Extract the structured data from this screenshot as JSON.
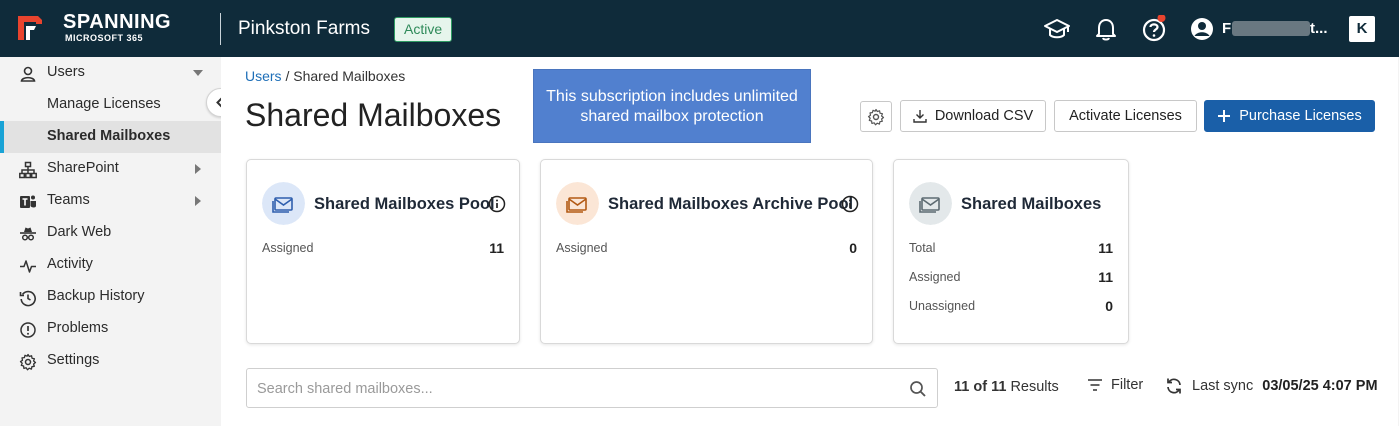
{
  "header": {
    "brand": "SPANNING",
    "brand_sub": "MICROSOFT 365",
    "org_name": "Pinkston Farms",
    "org_status": "Active",
    "user_initial": "F",
    "user_suffix": "t..."
  },
  "sidebar": {
    "items": [
      {
        "label": "Users",
        "icon": "user-icon"
      },
      {
        "label": "Manage Licenses"
      },
      {
        "label": "Shared Mailboxes"
      },
      {
        "label": "SharePoint",
        "icon": "sitemap-icon"
      },
      {
        "label": "Teams",
        "icon": "teams-icon"
      },
      {
        "label": "Dark Web",
        "icon": "spy-icon"
      },
      {
        "label": "Activity",
        "icon": "activity-icon"
      },
      {
        "label": "Backup History",
        "icon": "history-icon"
      },
      {
        "label": "Problems",
        "icon": "alert-circle-icon"
      },
      {
        "label": "Settings",
        "icon": "gear-icon"
      }
    ]
  },
  "main": {
    "breadcrumb_link": "Users",
    "breadcrumb_current": "/ Shared Mailboxes",
    "title": "Shared Mailboxes",
    "tooltip": "This subscription includes unlimited shared mailbox protection",
    "buttons": {
      "download": "Download CSV",
      "activate": "Activate Licenses",
      "purchase": "Purchase Licenses"
    },
    "cards": [
      {
        "title": "Shared Mailboxes Pool",
        "rows": [
          {
            "label": "Assigned",
            "value": "11"
          }
        ]
      },
      {
        "title": "Shared Mailboxes Archive Pool",
        "rows": [
          {
            "label": "Assigned",
            "value": "0"
          }
        ]
      },
      {
        "title": "Shared Mailboxes",
        "rows": [
          {
            "label": "Total",
            "value": "11"
          },
          {
            "label": "Assigned",
            "value": "11"
          },
          {
            "label": "Unassigned",
            "value": "0"
          }
        ]
      }
    ],
    "search_placeholder": "Search shared mailboxes...",
    "results_count": "11 of 11",
    "results_label": "Results",
    "filter_label": "Filter",
    "sync_label": "Last sync",
    "sync_time": "03/05/25 4:07 PM"
  },
  "colors": {
    "topbar": "#0f2b3a",
    "accent_blue": "#1a5fa8",
    "active_bar": "#19a3d6",
    "status_green": "#2e8a59",
    "tooltip_bg": "#5180cf"
  }
}
